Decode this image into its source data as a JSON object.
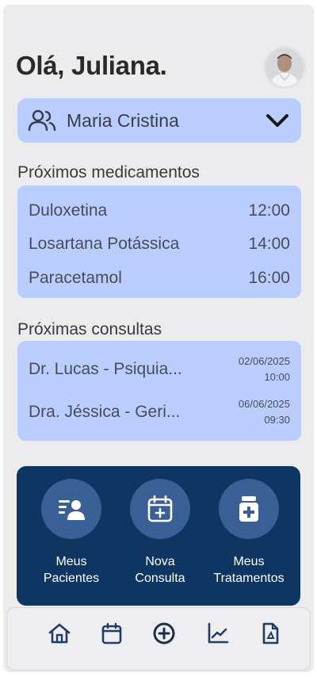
{
  "greeting": "Olá, Juliana.",
  "patient_selector": {
    "name": "Maria Cristina"
  },
  "medications": {
    "title": "Próximos medicamentos",
    "items": [
      {
        "name": "Duloxetina",
        "time": "12:00"
      },
      {
        "name": "Losartana Potássica",
        "time": "14:00"
      },
      {
        "name": "Paracetamol",
        "time": "16:00"
      }
    ]
  },
  "appointments": {
    "title": "Próximas consultas",
    "items": [
      {
        "doctor": "Dr. Lucas - Psiquia...",
        "date": "02/06/2025",
        "time": "10:00"
      },
      {
        "doctor": "Dra. Jéssica - Geri...",
        "date": "06/06/2025",
        "time": "09:30"
      }
    ]
  },
  "quick_actions": [
    {
      "line1": "Meus",
      "line2": "Pacientes",
      "icon": "patient-list-icon"
    },
    {
      "line1": "Nova",
      "line2": "Consulta",
      "icon": "calendar-plus-icon"
    },
    {
      "line1": "Meus",
      "line2": "Tratamentos",
      "icon": "medicine-bottle-icon"
    }
  ],
  "tab_icons": [
    "home-icon",
    "calendar-icon",
    "add-circle-icon",
    "chart-icon",
    "document-icon"
  ],
  "colors": {
    "background": "#ececee",
    "card": "#b9ceff",
    "action_panel": "#0f3562",
    "action_circle": "#3a5f95",
    "icon_dark": "#1f3d66"
  }
}
